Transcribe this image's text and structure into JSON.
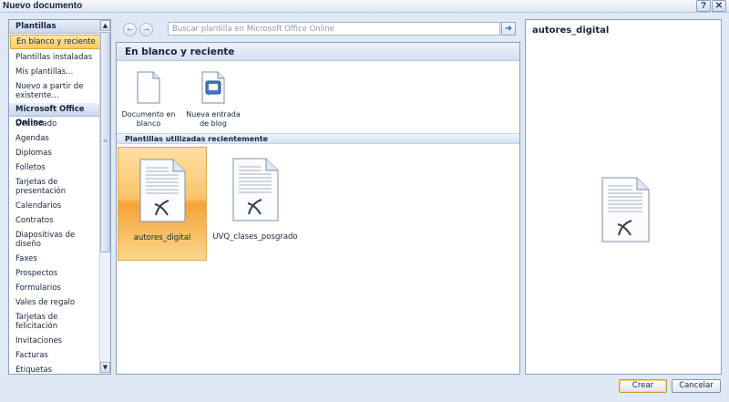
{
  "window": {
    "title": "Nuevo documento",
    "help_glyph": "?",
    "close_glyph": "✕"
  },
  "sidebar": {
    "header1": "Plantillas",
    "section1_items": [
      {
        "label": "En blanco y reciente",
        "selected": true
      },
      {
        "label": "Plantillas instaladas"
      },
      {
        "label": "Mis plantillas..."
      },
      {
        "label": "Nuevo a partir de existente..."
      }
    ],
    "header2": "Microsoft Office Online",
    "section2_items": [
      {
        "label": "Destacado"
      },
      {
        "label": "Agendas"
      },
      {
        "label": "Diplomas"
      },
      {
        "label": "Folletos"
      },
      {
        "label": "Tarjetas de presentación"
      },
      {
        "label": "Calendarios"
      },
      {
        "label": "Contratos"
      },
      {
        "label": "Diapositivas de diseño"
      },
      {
        "label": "Faxes"
      },
      {
        "label": "Prospectos"
      },
      {
        "label": "Formularios"
      },
      {
        "label": "Vales de regalo"
      },
      {
        "label": "Tarjetas de felicitación"
      },
      {
        "label": "Invitaciones"
      },
      {
        "label": "Facturas"
      },
      {
        "label": "Etiquetas"
      }
    ]
  },
  "search": {
    "placeholder": "Buscar plantilla en Microsoft Office Online",
    "back_glyph": "←",
    "forward_glyph": "→",
    "go_glyph": "➜"
  },
  "main": {
    "header": "En blanco y reciente",
    "top_templates": [
      {
        "label": "Documento en blanco",
        "icon": "blank-document-icon"
      },
      {
        "label": "Nueva entrada de blog",
        "icon": "blog-post-icon"
      }
    ],
    "recent_header": "Plantillas utilizadas recientemente",
    "recent_templates": [
      {
        "label": "autores_digital",
        "icon": "template-document-icon",
        "selected": true
      },
      {
        "label": "UVQ_clases_posgrado",
        "icon": "template-document-icon"
      }
    ]
  },
  "preview": {
    "title": "autores_digital"
  },
  "buttons": {
    "create": "Crear",
    "cancel": "Cancelar"
  },
  "colors": {
    "selection": "#f9c963",
    "panel_border": "#8ba1c2",
    "background": "#dfe8f5"
  }
}
